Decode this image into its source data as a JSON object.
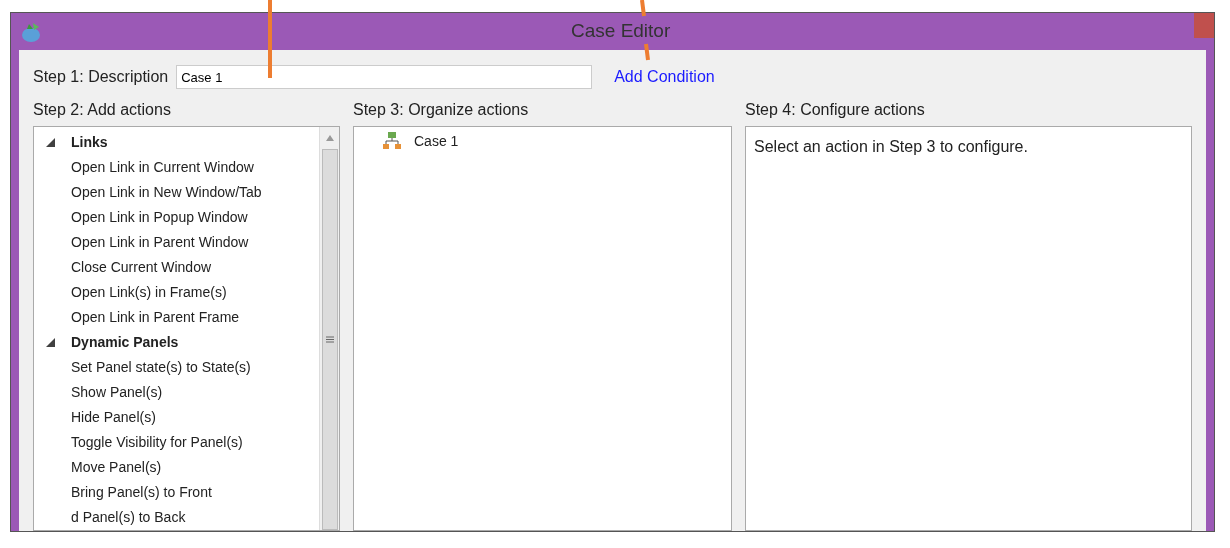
{
  "window": {
    "title": "Case Editor"
  },
  "step1": {
    "label": "Step 1: Description",
    "value": "Case 1",
    "link": "Add Condition"
  },
  "step2": {
    "label": "Step 2: Add actions",
    "groups": [
      {
        "label": "Links",
        "expanded": true,
        "children": [
          {
            "label": "Open Link in Current Window"
          },
          {
            "label": "Open Link in New Window/Tab"
          },
          {
            "label": "Open Link in Popup Window"
          },
          {
            "label": "Open Link in Parent Window"
          },
          {
            "label": "Close Current Window"
          },
          {
            "label": "Open Link(s) in Frame(s)"
          },
          {
            "label": "Open Link in Parent Frame"
          }
        ]
      },
      {
        "label": "Dynamic Panels",
        "expanded": true,
        "children": [
          {
            "label": "Set Panel state(s) to State(s)"
          },
          {
            "label": "Show Panel(s)"
          },
          {
            "label": "Hide Panel(s)"
          },
          {
            "label": "Toggle Visibility for Panel(s)"
          },
          {
            "label": "Move Panel(s)"
          },
          {
            "label": "Bring Panel(s) to Front"
          },
          {
            "label": "d Panel(s) to Back"
          }
        ]
      }
    ]
  },
  "step3": {
    "label": "Step 3: Organize actions",
    "items": [
      {
        "label": "Case 1"
      }
    ]
  },
  "step4": {
    "label": "Step 4: Configure actions",
    "message": "Select an action in Step 3 to configure."
  }
}
